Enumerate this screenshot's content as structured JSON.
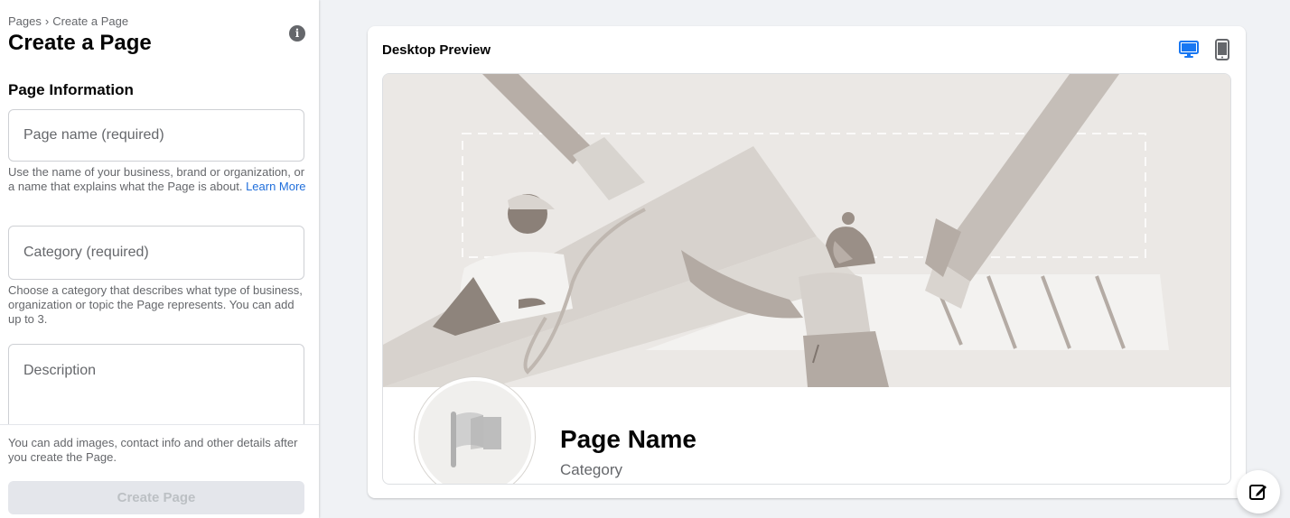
{
  "breadcrumb": {
    "parent": "Pages",
    "separator": "›",
    "current": "Create a Page"
  },
  "page_title": "Create a Page",
  "info_icon": "i",
  "section_title": "Page Information",
  "page_name_field": {
    "placeholder": "Page name (required)",
    "value": ""
  },
  "page_name_help": {
    "text": "Use the name of your business, brand or organization, or a name that explains what the Page is about. ",
    "link": "Learn More"
  },
  "category_field": {
    "placeholder": "Category (required)",
    "value": ""
  },
  "category_help": "Choose a category that describes what type of business, organization or topic the Page represents. You can add up to 3.",
  "description_field": {
    "placeholder": "Description",
    "value": ""
  },
  "bottom_note": "You can add images, contact info and other details after you create the Page.",
  "create_button": "Create Page",
  "preview": {
    "title": "Desktop Preview",
    "page_name": "Page Name",
    "category": "Category",
    "selected_device": "desktop"
  },
  "icons": [
    "info-icon",
    "desktop-icon",
    "mobile-icon",
    "flag-icon",
    "compose-icon"
  ],
  "colors": {
    "accent": "#216fdb",
    "cover_bg": "#ebe8e5",
    "disabled_button": "#e4e6eb"
  }
}
